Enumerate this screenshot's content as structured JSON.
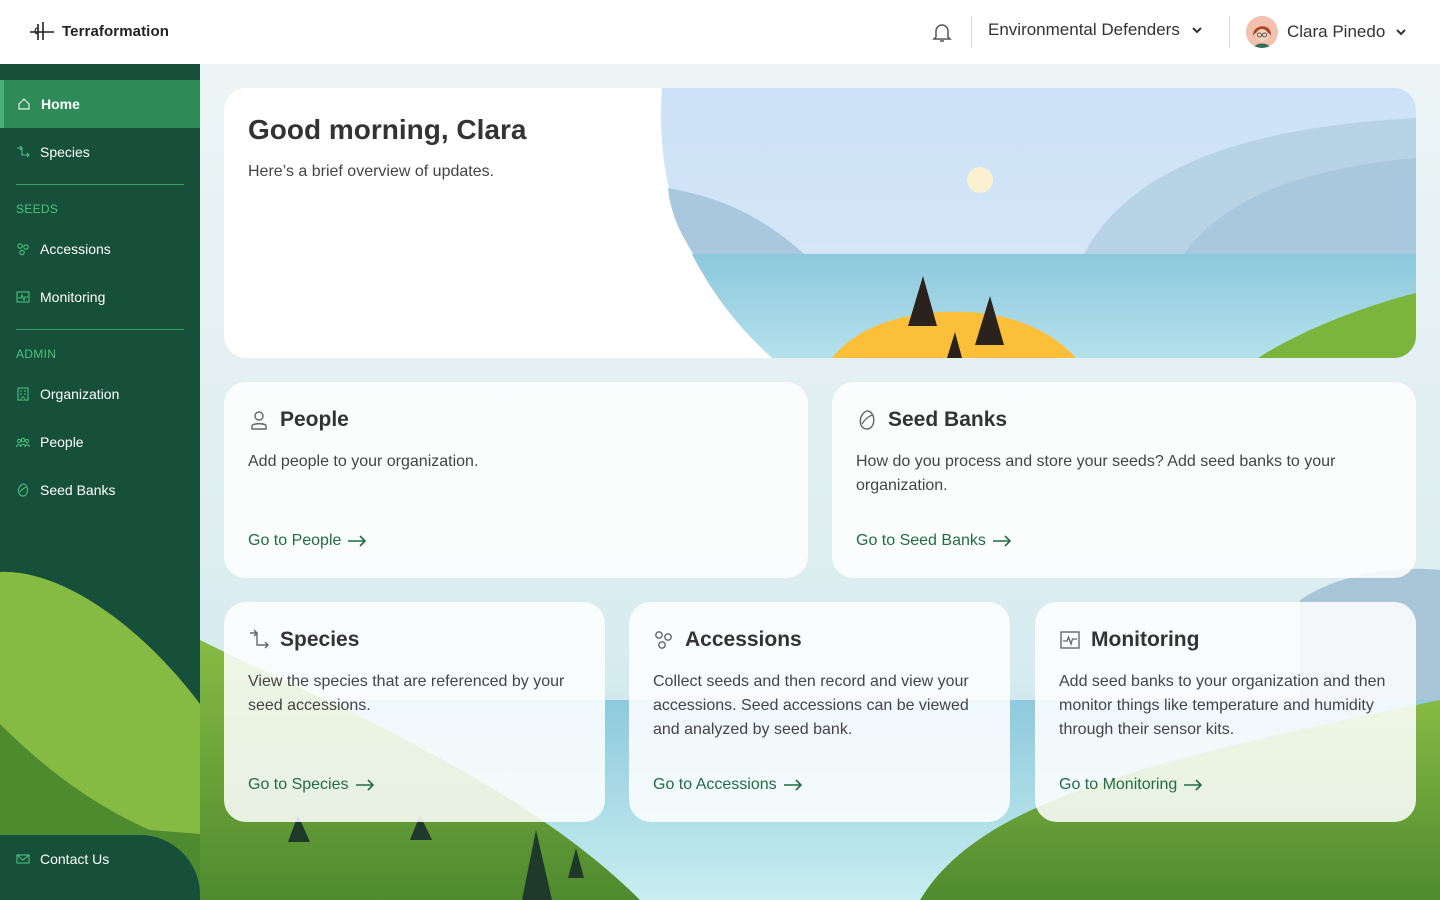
{
  "app": {
    "brand": "Terraformation"
  },
  "header": {
    "organization": "Environmental Defenders",
    "user_name": "Clara Pinedo",
    "icons": {
      "notifications": "bell-icon",
      "org_dropdown": "chevron-down-icon",
      "user_dropdown": "chevron-down-icon"
    }
  },
  "sidebar": {
    "items": [
      {
        "label": "Home",
        "icon": "home-icon",
        "active": true
      },
      {
        "label": "Species",
        "icon": "species-icon"
      }
    ],
    "sections": [
      {
        "title": "SEEDS",
        "items": [
          {
            "label": "Accessions",
            "icon": "accessions-icon"
          },
          {
            "label": "Monitoring",
            "icon": "monitoring-icon"
          }
        ]
      },
      {
        "title": "ADMIN",
        "items": [
          {
            "label": "Organization",
            "icon": "organization-icon"
          },
          {
            "label": "People",
            "icon": "people-icon"
          },
          {
            "label": "Seed Banks",
            "icon": "seed-bank-icon"
          }
        ]
      }
    ],
    "footer": {
      "label": "Contact Us",
      "icon": "mail-icon"
    }
  },
  "hero": {
    "title": "Good morning, Clara",
    "subtitle": "Here’s a brief overview of updates."
  },
  "cards": {
    "people": {
      "title": "People",
      "description": "Add people to your organization.",
      "link": "Go to People",
      "icon": "person-icon"
    },
    "seed_banks": {
      "title": "Seed Banks",
      "description": "How do you process and store your seeds? Add seed banks to your organization.",
      "link": "Go to Seed Banks",
      "icon": "seed-bank-icon"
    },
    "species": {
      "title": "Species",
      "description": "View the species that are referenced by your seed accessions.",
      "link": "Go to Species",
      "icon": "species-icon"
    },
    "accessions": {
      "title": "Accessions",
      "description": "Collect seeds and then record and view your accessions. Seed accessions can be viewed and analyzed by seed bank.",
      "link": "Go to Accessions",
      "icon": "accessions-icon"
    },
    "monitoring": {
      "title": "Monitoring",
      "description": "Add seed banks to your organization and then monitor things like temperature and humidity through their sensor kits.",
      "link": "Go to Monitoring",
      "icon": "monitoring-icon"
    }
  },
  "colors": {
    "sidebar": "#16503a",
    "active_nav": "#2e8b57",
    "section_label": "#4cc27c",
    "link": "#236b44",
    "hill_light": "#7bb53d",
    "hill_dark": "#3e7a2c",
    "sky": "#cfe3f7",
    "water": "#8ec9dd",
    "sun_island": "#fbbf3a"
  }
}
